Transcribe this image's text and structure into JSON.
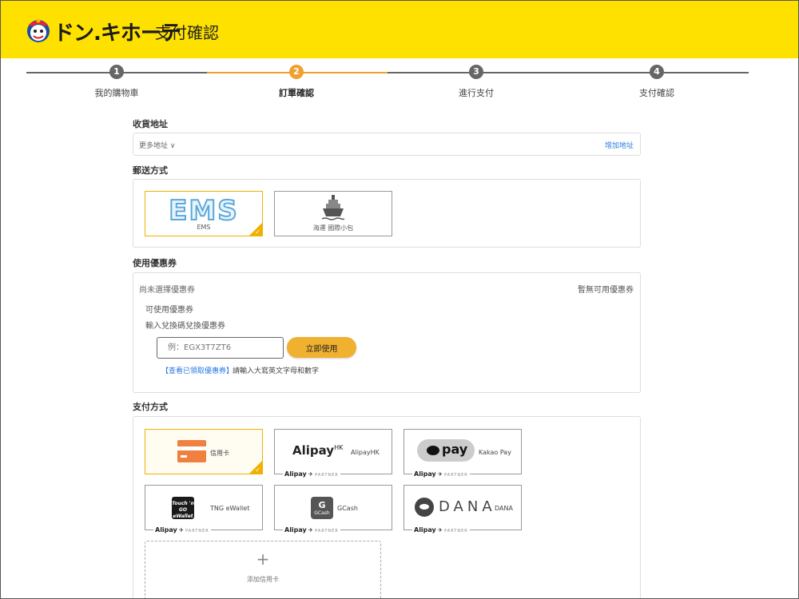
{
  "header": {
    "brand": "ドン.キホーテ",
    "title": "支付確認",
    "bg_color": "#ffe100"
  },
  "stepper": {
    "steps": [
      {
        "number": "1",
        "label": "我的購物車"
      },
      {
        "number": "2",
        "label": "訂單確認"
      },
      {
        "number": "3",
        "label": "進行支付"
      },
      {
        "number": "4",
        "label": "支付確認"
      }
    ],
    "active_step": 2,
    "accent": "#f0a030"
  },
  "address": {
    "section_label": "收貨地址",
    "more_label": "更多地址 ∨",
    "add_label": "增加地址"
  },
  "shipping": {
    "section_label": "郵送方式",
    "options": [
      {
        "logo": "EMS",
        "caption": "EMS",
        "selected": true
      },
      {
        "icon": "ship-icon",
        "caption": "海運 國際小包",
        "selected": false
      }
    ]
  },
  "coupon": {
    "section_label": "使用優惠券",
    "not_selected": "尚未選擇優惠券",
    "none_available": "暫無可用優惠券",
    "available_label": "可使用優惠券",
    "enter_label": "輸入兌換碼兌換優惠券",
    "input_placeholder": "例：EGX3T7ZT6",
    "apply_button": "立即使用",
    "view_link": "【查看已領取優惠券】",
    "hint": "請輸入大寫英文字母和數字"
  },
  "payment": {
    "section_label": "支付方式",
    "partner_brand": "Alipay",
    "partner_word": "PARTNER",
    "methods": [
      {
        "name": "信用卡",
        "selected": true
      },
      {
        "logo": "Alipay",
        "logo_suffix": "HK",
        "name": "AlipayHK"
      },
      {
        "logo": "pay",
        "name": "Kakao Pay"
      },
      {
        "logo": "Touch 'n GO eWallet",
        "name": "TNG eWallet"
      },
      {
        "logo": "G",
        "logo_sub": "GCash",
        "name": "GCash"
      },
      {
        "logo": "DANA",
        "name": "DANA"
      }
    ],
    "add_card_label": "添加信用卡",
    "add_card_plus": "+"
  }
}
